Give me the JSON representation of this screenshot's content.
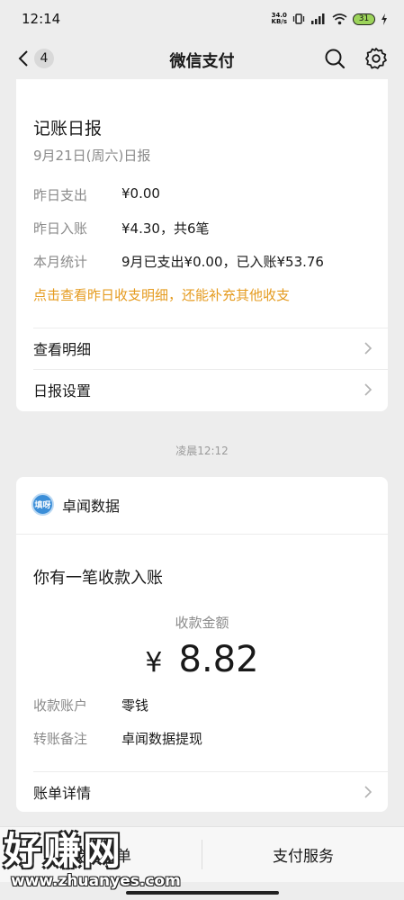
{
  "status_bar": {
    "time": "12:14",
    "net_speed_value": "34.0",
    "net_speed_unit": "KB/s",
    "battery": "31"
  },
  "nav": {
    "back_badge": "4",
    "title": "微信支付"
  },
  "daily_report": {
    "title": "记账日报",
    "subtitle": "9月21日(周六)日报",
    "rows": [
      {
        "label": "昨日支出",
        "value": "¥0.00"
      },
      {
        "label": "昨日入账",
        "value": "¥4.30，共6笔"
      },
      {
        "label": "本月统计",
        "value": "9月已支出¥0.00，已入账¥53.76"
      }
    ],
    "promo": "点击查看昨日收支明细，还能补充其他收支",
    "links": [
      {
        "label": "查看明细"
      },
      {
        "label": "日报设置"
      }
    ]
  },
  "timestamp": "凌晨12:12",
  "receipt": {
    "merchant": "卓闻数据",
    "merchant_logo_text": "填呀",
    "title": "你有一笔收款入账",
    "amount_label": "收款金额",
    "currency": "¥",
    "amount": "8.82",
    "rows": [
      {
        "label": "收款账户",
        "value": "零钱"
      },
      {
        "label": "转账备注",
        "value": "卓闻数据提现"
      }
    ],
    "detail_link": "账单详情"
  },
  "bottom_bar": {
    "left": "我的账单",
    "right": "支付服务"
  },
  "watermark": {
    "text": "好赚网",
    "url": "www.zhuanyes.com"
  },
  "colors": {
    "accent_orange": "#e59b1f",
    "background": "#ededed",
    "card": "#ffffff"
  }
}
